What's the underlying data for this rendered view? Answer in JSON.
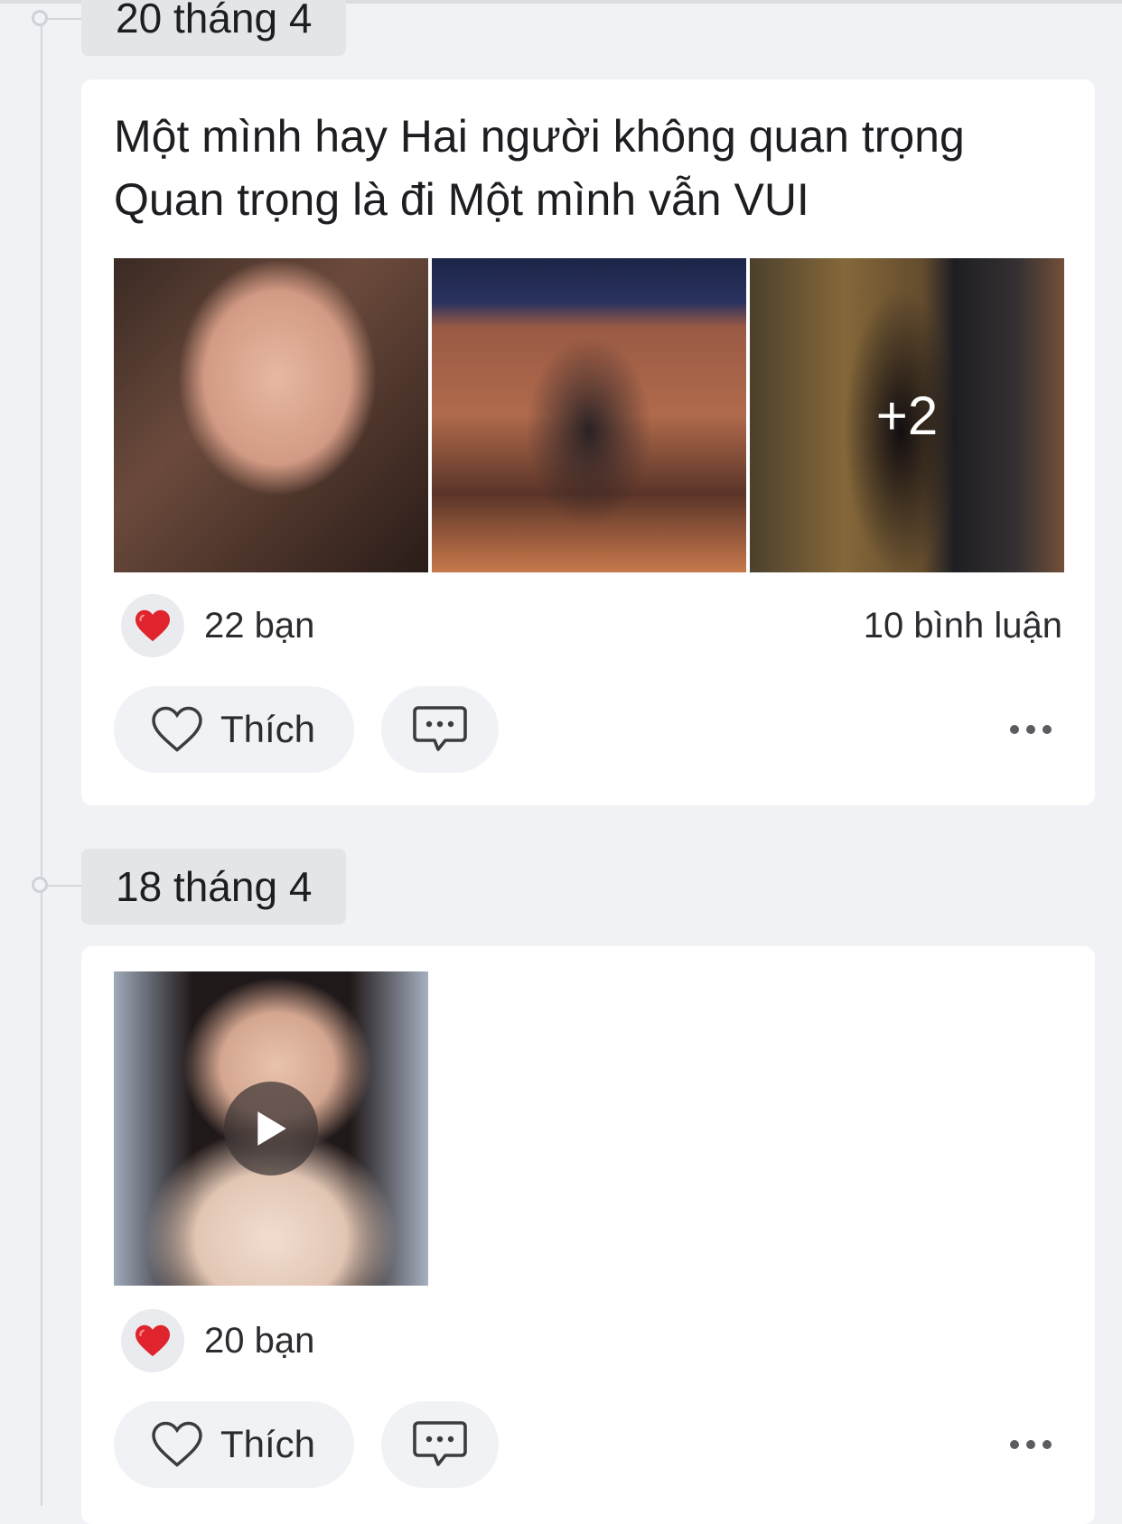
{
  "timeline": [
    {
      "date": "20 tháng 4",
      "text_lines": [
        "Một mình hay Hai người không quan trọng",
        "Quan trọng là đi Một mình vẫn VUI"
      ],
      "photos": [
        "photo-selfie",
        "photo-cinema-seat",
        "photo-movie-poster"
      ],
      "more_photos": "+2",
      "reactions": "22 bạn",
      "comments": "10 bình luận",
      "like_label": "Thích"
    },
    {
      "date": "18 tháng 4",
      "media": "video",
      "reactions": "20 bạn",
      "like_label": "Thích"
    }
  ],
  "colors": {
    "background": "#f1f2f5",
    "card": "#ffffff",
    "date_pill": "#e4e5e8",
    "heart": "#e0242d"
  },
  "icons": [
    "heart-reaction-icon",
    "heart-outline-icon",
    "comment-icon",
    "more-icon",
    "play-icon"
  ]
}
